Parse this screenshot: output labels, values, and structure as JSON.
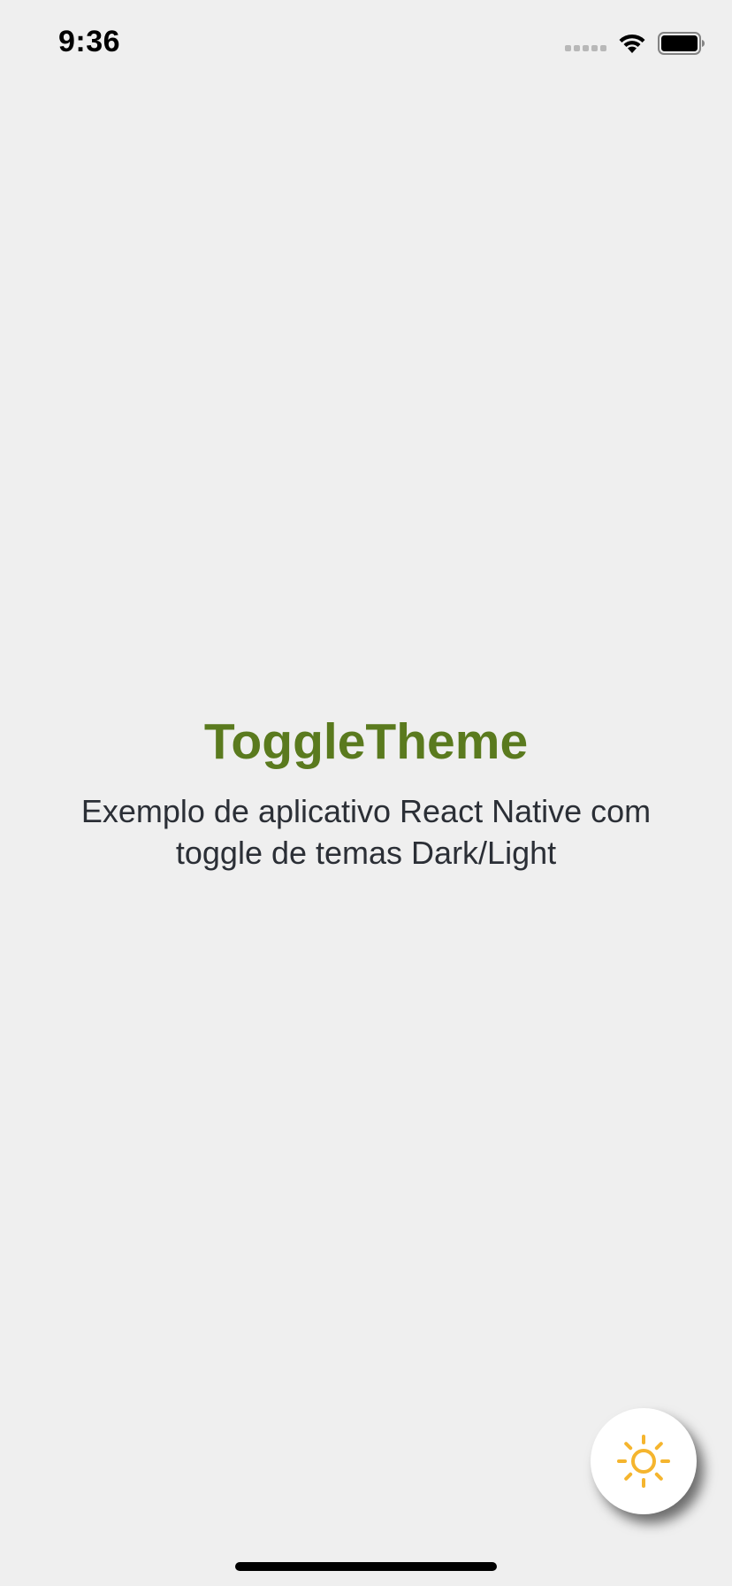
{
  "status_bar": {
    "time": "9:36"
  },
  "main": {
    "title": "ToggleTheme",
    "subtitle": "Exemplo de aplicativo React Native com toggle de temas Dark/Light"
  },
  "theme_toggle": {
    "icon": "sun-icon",
    "icon_color": "#f5b52e"
  },
  "colors": {
    "background": "#efefef",
    "title": "#5a7a1e",
    "subtitle": "#2b2f36",
    "button_background": "#ffffff"
  }
}
